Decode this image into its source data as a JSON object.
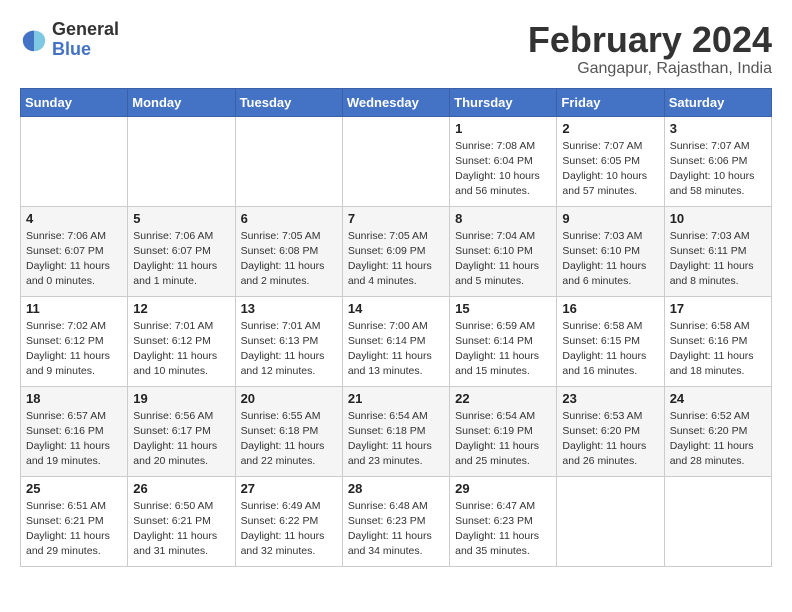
{
  "logo": {
    "general": "General",
    "blue": "Blue"
  },
  "title": {
    "month_year": "February 2024",
    "location": "Gangapur, Rajasthan, India"
  },
  "days_of_week": [
    "Sunday",
    "Monday",
    "Tuesday",
    "Wednesday",
    "Thursday",
    "Friday",
    "Saturday"
  ],
  "weeks": [
    [
      {
        "day": "",
        "info": ""
      },
      {
        "day": "",
        "info": ""
      },
      {
        "day": "",
        "info": ""
      },
      {
        "day": "",
        "info": ""
      },
      {
        "day": "1",
        "info": "Sunrise: 7:08 AM\nSunset: 6:04 PM\nDaylight: 10 hours\nand 56 minutes."
      },
      {
        "day": "2",
        "info": "Sunrise: 7:07 AM\nSunset: 6:05 PM\nDaylight: 10 hours\nand 57 minutes."
      },
      {
        "day": "3",
        "info": "Sunrise: 7:07 AM\nSunset: 6:06 PM\nDaylight: 10 hours\nand 58 minutes."
      }
    ],
    [
      {
        "day": "4",
        "info": "Sunrise: 7:06 AM\nSunset: 6:07 PM\nDaylight: 11 hours\nand 0 minutes."
      },
      {
        "day": "5",
        "info": "Sunrise: 7:06 AM\nSunset: 6:07 PM\nDaylight: 11 hours\nand 1 minute."
      },
      {
        "day": "6",
        "info": "Sunrise: 7:05 AM\nSunset: 6:08 PM\nDaylight: 11 hours\nand 2 minutes."
      },
      {
        "day": "7",
        "info": "Sunrise: 7:05 AM\nSunset: 6:09 PM\nDaylight: 11 hours\nand 4 minutes."
      },
      {
        "day": "8",
        "info": "Sunrise: 7:04 AM\nSunset: 6:10 PM\nDaylight: 11 hours\nand 5 minutes."
      },
      {
        "day": "9",
        "info": "Sunrise: 7:03 AM\nSunset: 6:10 PM\nDaylight: 11 hours\nand 6 minutes."
      },
      {
        "day": "10",
        "info": "Sunrise: 7:03 AM\nSunset: 6:11 PM\nDaylight: 11 hours\nand 8 minutes."
      }
    ],
    [
      {
        "day": "11",
        "info": "Sunrise: 7:02 AM\nSunset: 6:12 PM\nDaylight: 11 hours\nand 9 minutes."
      },
      {
        "day": "12",
        "info": "Sunrise: 7:01 AM\nSunset: 6:12 PM\nDaylight: 11 hours\nand 10 minutes."
      },
      {
        "day": "13",
        "info": "Sunrise: 7:01 AM\nSunset: 6:13 PM\nDaylight: 11 hours\nand 12 minutes."
      },
      {
        "day": "14",
        "info": "Sunrise: 7:00 AM\nSunset: 6:14 PM\nDaylight: 11 hours\nand 13 minutes."
      },
      {
        "day": "15",
        "info": "Sunrise: 6:59 AM\nSunset: 6:14 PM\nDaylight: 11 hours\nand 15 minutes."
      },
      {
        "day": "16",
        "info": "Sunrise: 6:58 AM\nSunset: 6:15 PM\nDaylight: 11 hours\nand 16 minutes."
      },
      {
        "day": "17",
        "info": "Sunrise: 6:58 AM\nSunset: 6:16 PM\nDaylight: 11 hours\nand 18 minutes."
      }
    ],
    [
      {
        "day": "18",
        "info": "Sunrise: 6:57 AM\nSunset: 6:16 PM\nDaylight: 11 hours\nand 19 minutes."
      },
      {
        "day": "19",
        "info": "Sunrise: 6:56 AM\nSunset: 6:17 PM\nDaylight: 11 hours\nand 20 minutes."
      },
      {
        "day": "20",
        "info": "Sunrise: 6:55 AM\nSunset: 6:18 PM\nDaylight: 11 hours\nand 22 minutes."
      },
      {
        "day": "21",
        "info": "Sunrise: 6:54 AM\nSunset: 6:18 PM\nDaylight: 11 hours\nand 23 minutes."
      },
      {
        "day": "22",
        "info": "Sunrise: 6:54 AM\nSunset: 6:19 PM\nDaylight: 11 hours\nand 25 minutes."
      },
      {
        "day": "23",
        "info": "Sunrise: 6:53 AM\nSunset: 6:20 PM\nDaylight: 11 hours\nand 26 minutes."
      },
      {
        "day": "24",
        "info": "Sunrise: 6:52 AM\nSunset: 6:20 PM\nDaylight: 11 hours\nand 28 minutes."
      }
    ],
    [
      {
        "day": "25",
        "info": "Sunrise: 6:51 AM\nSunset: 6:21 PM\nDaylight: 11 hours\nand 29 minutes."
      },
      {
        "day": "26",
        "info": "Sunrise: 6:50 AM\nSunset: 6:21 PM\nDaylight: 11 hours\nand 31 minutes."
      },
      {
        "day": "27",
        "info": "Sunrise: 6:49 AM\nSunset: 6:22 PM\nDaylight: 11 hours\nand 32 minutes."
      },
      {
        "day": "28",
        "info": "Sunrise: 6:48 AM\nSunset: 6:23 PM\nDaylight: 11 hours\nand 34 minutes."
      },
      {
        "day": "29",
        "info": "Sunrise: 6:47 AM\nSunset: 6:23 PM\nDaylight: 11 hours\nand 35 minutes."
      },
      {
        "day": "",
        "info": ""
      },
      {
        "day": "",
        "info": ""
      }
    ]
  ]
}
